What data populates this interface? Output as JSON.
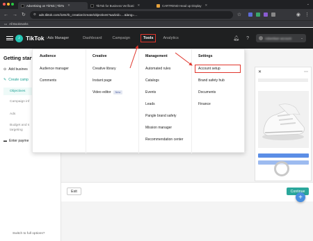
{
  "browser": {
    "tabs": [
      {
        "label": "Advertising on TikTok | TikTo",
        "active": true,
        "favicon_color": "#111111"
      },
      {
        "label": "TikTok for Business Verificati",
        "active": false,
        "favicon_color": "#111111"
      },
      {
        "label": "CARTREND Head up Display",
        "active": false,
        "favicon_color": "#e6a23c"
      }
    ],
    "url": "ads.tiktok.com/i18n/rb_creation/create/objectives?aadvid=…&lang=…",
    "bookmarks_label": "All Bookmarks",
    "extension_colors": [
      "#5d6bd8",
      "#3aa66b",
      "#8a5cd1",
      "#888888"
    ]
  },
  "topnav": {
    "brand": "TikTok",
    "brand_sub": ": Ads Manager",
    "links": [
      "Dashboard",
      "Campaign",
      "Tools",
      "Analytics"
    ],
    "account_name": "Advertiser account"
  },
  "sidebar": {
    "title": "Getting start",
    "add_business": "Add busines",
    "create_campaign": "Create camp",
    "objectives": "Objectives",
    "campaign_info": "Campaign inf",
    "ads": "Ads",
    "budget": "Budget and s",
    "targeting": "targeting",
    "enter_payment": "Enter payme",
    "switch_link": "Switch to full options?"
  },
  "dropdown": {
    "audience": {
      "heading": "Audience",
      "items": [
        "Audience manager",
        "Comments"
      ]
    },
    "creative": {
      "heading": "Creative",
      "items": [
        "Creative library",
        "Instant page",
        "Video editor"
      ],
      "badge": "New"
    },
    "management": {
      "heading": "Management",
      "items": [
        "Automated rules",
        "Catalogs",
        "Events",
        "Leads",
        "Pangle brand safety",
        "Mission manager",
        "Recommendation center"
      ]
    },
    "settings": {
      "heading": "Settings",
      "items": [
        "Account setup",
        "Brand safety hub",
        "Documents",
        "Finance"
      ]
    }
  },
  "footer": {
    "exit": "Exit",
    "continue": "Continue"
  },
  "colors": {
    "highlight": "#e0352b",
    "accent": "#2aa79b",
    "nav_bg": "#1f2021"
  }
}
